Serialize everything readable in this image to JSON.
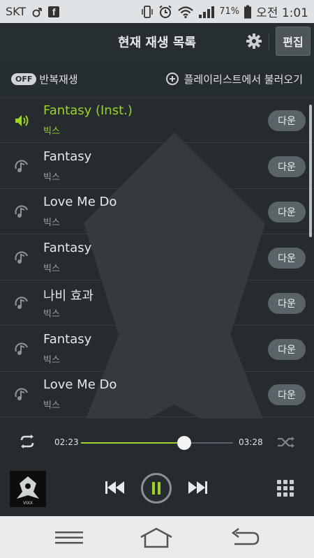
{
  "status_bar": {
    "carrier": "SKT",
    "battery": "71%",
    "time": "오전 1:01"
  },
  "header": {
    "title": "현재 재생 목록",
    "edit_label": "편집"
  },
  "toolbar": {
    "repeat_badge": "OFF",
    "repeat_label": "반복재생",
    "load_playlist": "플레이리스트에서 불러오기"
  },
  "playlist": [
    {
      "title": "Fantasy (Inst.)",
      "artist": "빅스",
      "down": "다운",
      "active": true
    },
    {
      "title": "Fantasy",
      "artist": "빅스",
      "down": "다운",
      "active": false
    },
    {
      "title": "Love Me Do",
      "artist": "빅스",
      "down": "다운",
      "active": false
    },
    {
      "title": "Fantasy",
      "artist": "빅스",
      "down": "다운",
      "active": false
    },
    {
      "title": "나비 효과",
      "artist": "빅스",
      "down": "다운",
      "active": false
    },
    {
      "title": "Fantasy",
      "artist": "빅스",
      "down": "다운",
      "active": false
    },
    {
      "title": "Love Me Do",
      "artist": "빅스",
      "down": "다운",
      "active": false
    }
  ],
  "player": {
    "elapsed": "02:23",
    "duration": "03:28",
    "progress": 0.68,
    "album_text": "VIXX",
    "watermark": "VIXX"
  },
  "colors": {
    "accent": "#9bd32c",
    "background": "#252b2e"
  },
  "icons": [
    "alarm-icon",
    "facebook-icon",
    "vibrate-icon",
    "wifi-icon",
    "signal-icon",
    "battery-icon",
    "gear-icon",
    "plus-circle-icon",
    "speaker-icon",
    "music-note-icon",
    "repeat-icon",
    "shuffle-icon",
    "prev-icon",
    "pause-icon",
    "next-icon",
    "grid-icon",
    "menu-icon",
    "home-icon",
    "back-icon"
  ]
}
